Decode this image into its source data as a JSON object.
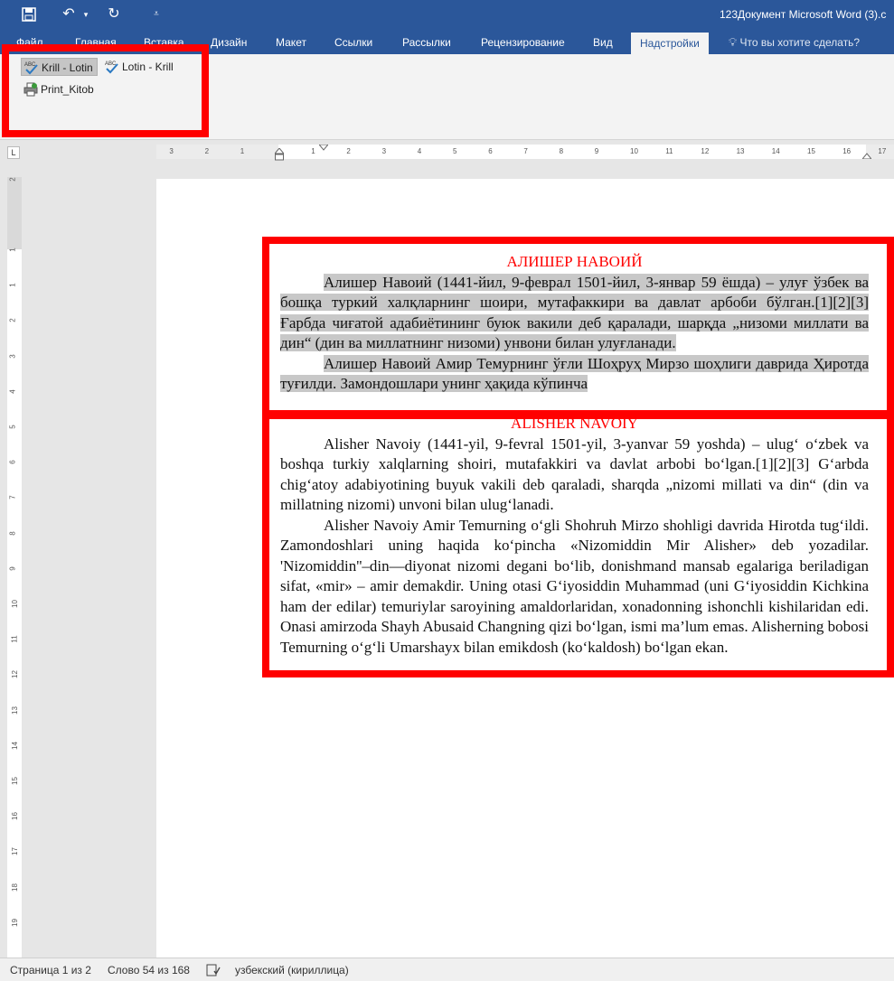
{
  "titlebar": {
    "doc_title": "123Документ Microsoft Word (3).c"
  },
  "tabs": [
    {
      "label": "Файл"
    },
    {
      "label": "Главная"
    },
    {
      "label": "Вставка"
    },
    {
      "label": "Дизайн"
    },
    {
      "label": "Макет"
    },
    {
      "label": "Ссылки"
    },
    {
      "label": "Рассылки"
    },
    {
      "label": "Рецензирование"
    },
    {
      "label": "Вид"
    },
    {
      "label": "Надстройки",
      "active": true
    }
  ],
  "tell_me": "Что вы хотите сделать?",
  "ribbon": {
    "krill_lotin": "Krill - Lotin",
    "lotin_krill": "Lotin - Krill",
    "print_kitob": "Print_Kitob"
  },
  "ruler": {
    "h_labels": [
      "3",
      "2",
      "1",
      "1",
      "2",
      "3",
      "4",
      "5",
      "6",
      "7",
      "8",
      "9",
      "10",
      "11",
      "12",
      "13",
      "14",
      "15",
      "16",
      "17"
    ],
    "v_labels": [
      "2",
      "1",
      "1",
      "2",
      "3",
      "4",
      "5",
      "6",
      "7",
      "8",
      "9",
      "10",
      "11",
      "12",
      "13",
      "14",
      "15",
      "16",
      "17",
      "18",
      "19"
    ],
    "corner": "L"
  },
  "document": {
    "cyr_title": "АЛИШЕР НАВОИЙ",
    "cyr_p1": "Алишер Навоий (1441-йил, 9-феврал 1501-йил, 3-январ 59 ёшда) – улуғ ўзбек ва бошқа туркий халқларнинг шоири, мутафаккири ва давлат арбоби бўлган.[1][2][3] Ғарбда чиғатой адабиётининг буюк вакили деб қаралади, шарқда „низоми миллати ва дин“ (дин ва миллатнинг низоми) унвони билан улуғланади.",
    "cyr_p2": "Алишер Навоий Амир Темурнинг ўғли Шоҳруҳ Мирзо шоҳлиги даврида Ҳиротда туғилди. Замондошлари унинг ҳақида кўпинча",
    "lat_title": "ALISHER NAVOIY",
    "lat_p1": "Alisher Navoiy (1441-yil, 9-fevral 1501-yil, 3-yanvar 59 yoshda) – ulug‘ o‘zbek va boshqa turkiy xalqlarning shoiri, mutafakkiri va davlat arbobi bo‘lgan.[1][2][3] G‘arbda chig‘atoy adabiyotining buyuk vakili deb qaraladi, sharqda „nizomi millati va din“ (din va millatning nizomi) unvoni bilan ulug‘lanadi.",
    "lat_p2": "Alisher Navoiy Amir Temurning o‘gli Shohruh Mirzo shohligi davrida Hirotda tug‘ildi. Zamondoshlari uning haqida ko‘pincha «Nizomiddin Mir Alisher» deb yozadilar. 'Nizomiddin''–din—diyonat nizomi degani bo‘lib, donishmand mansab egalariga beriladigan sifat, «mir» – amir demakdir. Uning otasi G‘iyosiddin Muhammad (uni G‘iyosiddin Kichkina ham der edilar) temuriylar saroyining amaldorlaridan, xonadonning ishonchli kishilaridan edi. Onasi amirzoda Shayh Abusaid Changning qizi bo‘lgan, ismi ma’lum emas. Alisherning bobosi Temurning o‘g‘li Umarshayx bilan emikdosh (ko‘kaldosh) bo‘lgan ekan."
  },
  "status": {
    "page": "Страница 1 из 2",
    "words": "Слово 54 из 168",
    "language": "узбекский (кириллица)"
  },
  "colors": {
    "ribbon_blue": "#2b579a",
    "highlight_red": "#ff0000",
    "selection_grey": "#c8c8c8"
  }
}
